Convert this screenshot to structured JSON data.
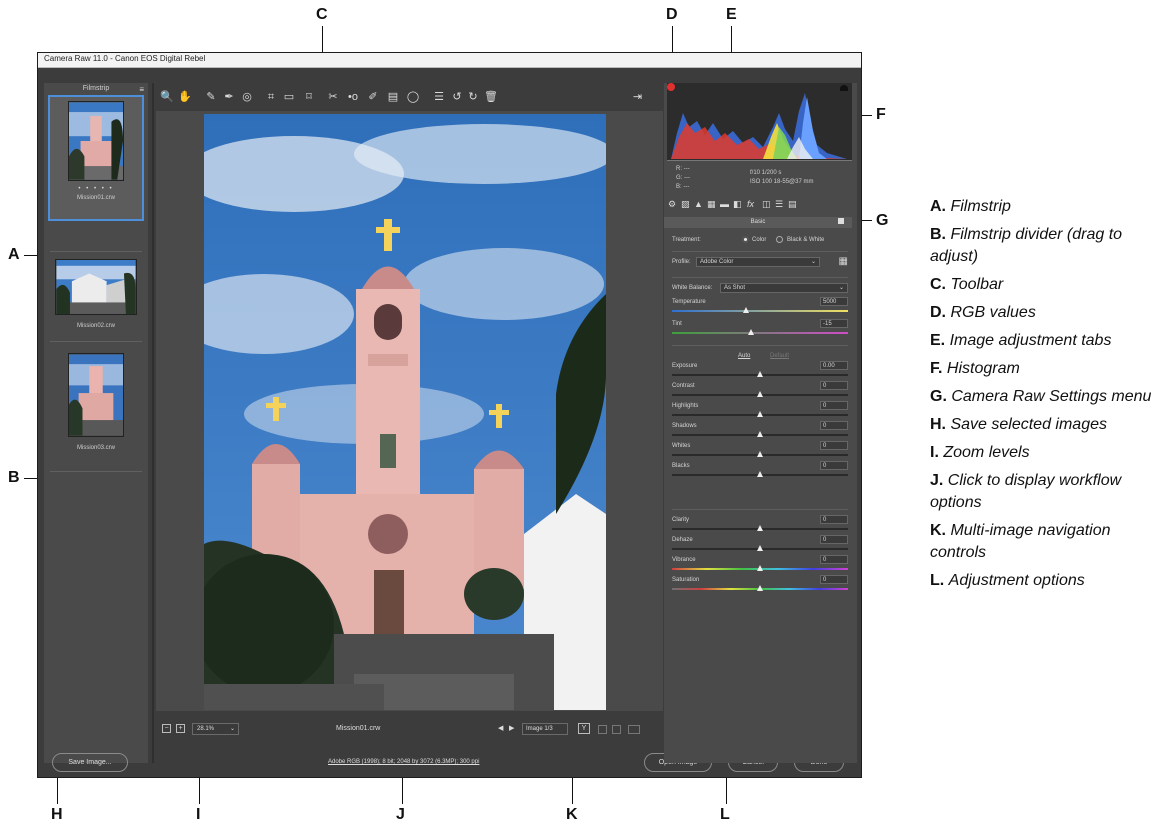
{
  "window": {
    "title": "Camera Raw 11.0  -  Canon EOS Digital Rebel"
  },
  "filmstrip": {
    "header": "Filmstrip",
    "items": [
      {
        "name": "Mission01.crw",
        "stars": "• • • • •",
        "selected": true
      },
      {
        "name": "Mission02.crw"
      },
      {
        "name": "Mission03.crw"
      }
    ]
  },
  "toolbar": {
    "tools": [
      "zoom-icon",
      "hand-icon",
      "white-balance-icon",
      "color-sampler-icon",
      "targeted-adjustment-icon",
      "crop-icon",
      "straighten-icon",
      "transform-icon",
      "spot-removal-icon",
      "red-eye-icon",
      "adjustment-brush-icon",
      "graduated-filter-icon",
      "radial-filter-icon",
      "preferences-icon",
      "rotate-ccw-icon",
      "rotate-cw-icon",
      "trash-icon"
    ],
    "glyphs": [
      "🔍",
      "✋",
      "✎",
      "✒",
      "◎",
      "⌗",
      "▭",
      "⌑",
      "✂",
      "•o",
      "✐",
      "▤",
      "◯",
      "☰",
      "↺",
      "↻",
      "🗑"
    ]
  },
  "preview": {
    "filename": "Mission01.crw",
    "zoom": "28.1%",
    "zoom_minus": "−",
    "zoom_plus": "+",
    "image_count": "Image 1/3",
    "nav_prev": "◀",
    "nav_next": "▶",
    "compare_label": "Y"
  },
  "footer": {
    "save_label": "Save Image...",
    "workflow": "Adobe RGB (1998); 8 bit; 2048 by 3072 (6.3MP); 300 ppi",
    "open_label": "Open Image",
    "cancel_label": "Cancel",
    "done_label": "Done"
  },
  "info": {
    "r": "R:    ---",
    "g": "G:    ---",
    "b": "B:    ---",
    "aperture_shutter": "f/10    1/200 s",
    "iso_lens": "ISO 100    18-55@37 mm"
  },
  "panel": {
    "title": "Basic",
    "treatment_label": "Treatment:",
    "treatment_color": "Color",
    "treatment_bw": "Black & White",
    "profile_label": "Profile:",
    "profile_value": "Adobe Color",
    "wb_label": "White Balance:",
    "wb_value": "As Shot",
    "auto_label": "Auto",
    "default_label": "Default",
    "sliders": [
      {
        "label": "Temperature",
        "value": "5000",
        "pos": 0.42
      },
      {
        "label": "Tint",
        "value": "-15",
        "pos": 0.45
      },
      {
        "label": "Exposure",
        "value": "0.00",
        "pos": 0.5
      },
      {
        "label": "Contrast",
        "value": "0",
        "pos": 0.5
      },
      {
        "label": "Highlights",
        "value": "0",
        "pos": 0.5
      },
      {
        "label": "Shadows",
        "value": "0",
        "pos": 0.5
      },
      {
        "label": "Whites",
        "value": "0",
        "pos": 0.5
      },
      {
        "label": "Blacks",
        "value": "0",
        "pos": 0.5
      },
      {
        "label": "Clarity",
        "value": "0",
        "pos": 0.5
      },
      {
        "label": "Dehaze",
        "value": "0",
        "pos": 0.5
      },
      {
        "label": "Vibrance",
        "value": "0",
        "pos": 0.5
      },
      {
        "label": "Saturation",
        "value": "0",
        "pos": 0.5
      }
    ]
  },
  "callouts": [
    "A",
    "B",
    "C",
    "D",
    "E",
    "F",
    "G",
    "H",
    "I",
    "J",
    "K",
    "L"
  ],
  "legend": [
    {
      "letter": "A.",
      "text": "Filmstrip"
    },
    {
      "letter": "B.",
      "text": "Filmstrip divider (drag to adjust)"
    },
    {
      "letter": "C.",
      "text": "Toolbar"
    },
    {
      "letter": "D.",
      "text": "RGB values"
    },
    {
      "letter": "E.",
      "text": "Image adjustment tabs"
    },
    {
      "letter": "F.",
      "text": "Histogram"
    },
    {
      "letter": "G.",
      "text": "Camera Raw Settings menu"
    },
    {
      "letter": "H.",
      "text": "Save selected images"
    },
    {
      "letter": "I.",
      "text": "Zoom levels"
    },
    {
      "letter": "J.",
      "text": "Click to display workflow options"
    },
    {
      "letter": "K.",
      "text": "Multi-image navigation controls"
    },
    {
      "letter": "L.",
      "text": "Adjustment options"
    }
  ]
}
